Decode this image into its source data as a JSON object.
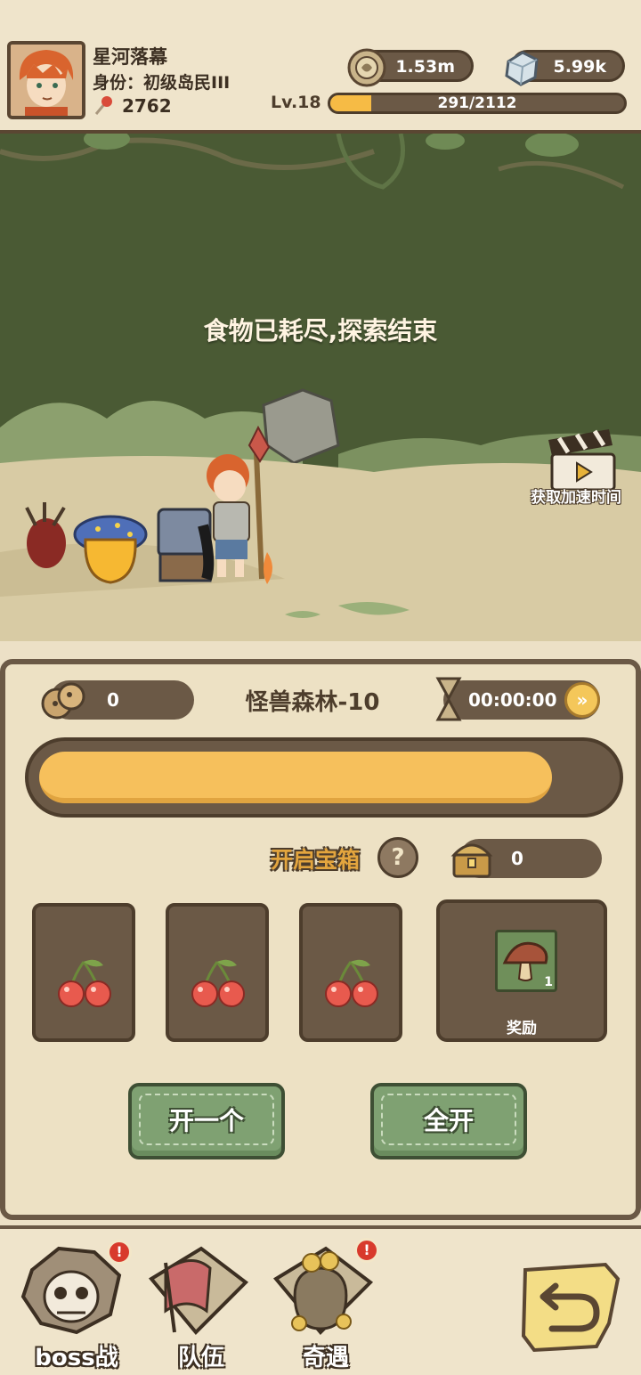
{
  "player": {
    "name": "星河落幕",
    "rank": "身份：初级岛民III",
    "power": "2762",
    "level": "Lv.18",
    "xp_text": "291/2112",
    "xp_fraction": 0.138
  },
  "resources": {
    "coins": "1.53m",
    "gems": "5.99k"
  },
  "scene": {
    "message": "食物已耗尽,探索结束",
    "speedup_label": "获取加速时间"
  },
  "explore": {
    "food_count": "0",
    "stage_name": "怪兽森林-10",
    "timer": "00:00:00",
    "fast_forward_symbol": "»",
    "progress_fraction": 0.9,
    "chest_title": "开启宝箱",
    "help_symbol": "?",
    "chest_count": "0",
    "slots": [
      {
        "icon": "cherry-icon"
      },
      {
        "icon": "cherry-icon"
      },
      {
        "icon": "cherry-icon"
      }
    ],
    "reward": {
      "icon": "mushroom-item-icon",
      "quantity": "1",
      "label": "奖励"
    },
    "open_one_label": "开一个",
    "open_all_label": "全开"
  },
  "nav": {
    "boss_label": "boss战",
    "team_label": "队伍",
    "encounter_label": "奇遇",
    "badge_symbol": "!"
  },
  "colors": {
    "accent_yellow": "#f6bb45",
    "panel_brown": "#6b5946",
    "button_green": "#7fa172",
    "badge_red": "#d83a2c",
    "jungle_green": "#4a5a34"
  }
}
